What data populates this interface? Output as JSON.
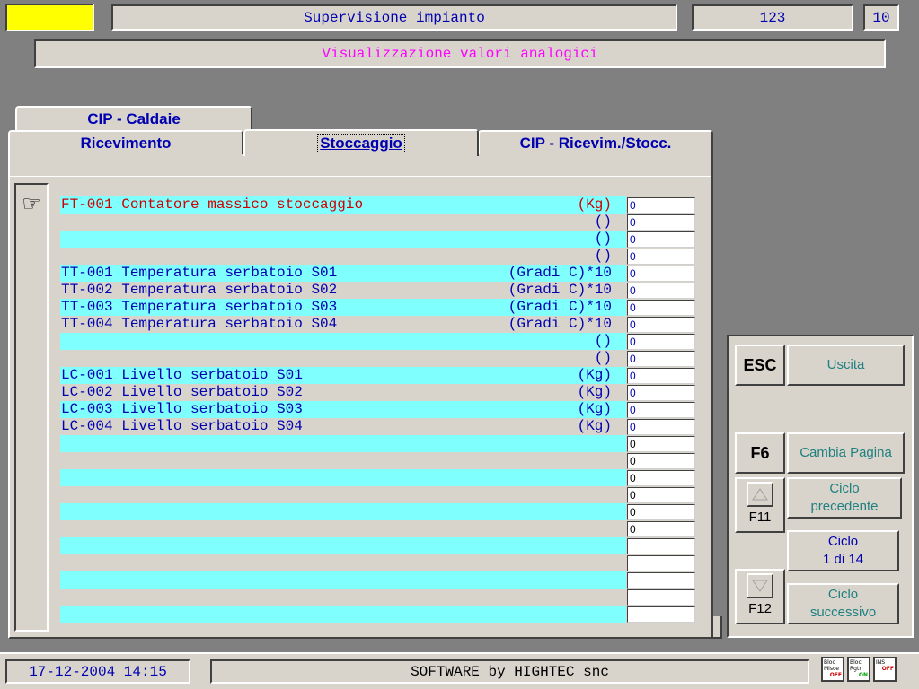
{
  "header": {
    "title": "Supervisione impianto",
    "code": "123",
    "num": "10",
    "subtitle": "Visualizzazione valori analogici"
  },
  "tabs": {
    "back": [
      "CIP - Caldaie"
    ],
    "front": [
      {
        "label": "Ricevimento",
        "active": false
      },
      {
        "label": "Stoccaggio",
        "active": true
      },
      {
        "label": "CIP - Ricevim./Stocc.",
        "active": false
      }
    ]
  },
  "pointer_icon": "☞",
  "rows": [
    {
      "label": "FT-001 Contatore massico stoccaggio",
      "unit": "(Kg)",
      "value": "0",
      "selected": true
    },
    {
      "label": "",
      "unit": "()",
      "value": "0"
    },
    {
      "label": "",
      "unit": "()",
      "value": "0"
    },
    {
      "label": "",
      "unit": "()",
      "value": "0"
    },
    {
      "label": "TT-001 Temperatura serbatoio S01",
      "unit": "(Gradi C)*10",
      "value": "0"
    },
    {
      "label": "TT-002 Temperatura serbatoio S02",
      "unit": "(Gradi C)*10",
      "value": "0"
    },
    {
      "label": "TT-003 Temperatura serbatoio S03",
      "unit": "(Gradi C)*10",
      "value": "0"
    },
    {
      "label": "TT-004 Temperatura serbatoio S04",
      "unit": "(Gradi C)*10",
      "value": "0"
    },
    {
      "label": "",
      "unit": "()",
      "value": "0"
    },
    {
      "label": "",
      "unit": "()",
      "value": "0"
    },
    {
      "label": "LC-001 Livello serbatoio S01",
      "unit": "(Kg)",
      "value": "0"
    },
    {
      "label": "LC-002 Livello serbatoio S02",
      "unit": "(Kg)",
      "value": "0"
    },
    {
      "label": "LC-003 Livello serbatoio S03",
      "unit": "(Kg)",
      "value": "0"
    },
    {
      "label": "LC-004 Livello serbatoio S04",
      "unit": "(Kg)",
      "value": "0"
    },
    {
      "label": "",
      "unit": "",
      "value": "0"
    },
    {
      "label": "",
      "unit": "",
      "value": "0"
    },
    {
      "label": "",
      "unit": "",
      "value": "0"
    },
    {
      "label": "",
      "unit": "",
      "value": "0"
    },
    {
      "label": "",
      "unit": "",
      "value": "0"
    },
    {
      "label": "",
      "unit": "",
      "value": "0"
    },
    {
      "label": "",
      "unit": "",
      "value": ""
    },
    {
      "label": "",
      "unit": "",
      "value": ""
    },
    {
      "label": "",
      "unit": "",
      "value": ""
    },
    {
      "label": "",
      "unit": "",
      "value": ""
    },
    {
      "label": "",
      "unit": "",
      "value": ""
    }
  ],
  "functions": {
    "esc": {
      "key": "ESC",
      "label": "Uscita"
    },
    "f6": {
      "key": "F6",
      "label": "Cambia Pagina"
    },
    "f11": {
      "key": "F11",
      "label": "Ciclo\nprecedente",
      "icon": "up-triangle-icon"
    },
    "cycle": {
      "label": "Ciclo\n1 di 14"
    },
    "f12": {
      "key": "F12",
      "label": "Ciclo\nsuccessivo",
      "icon": "down-triangle-icon"
    }
  },
  "footer": {
    "datetime": "17-12-2004 14:15",
    "software": "SOFTWARE by HIGHTEC snc",
    "indicators": [
      {
        "top": "Bloc",
        "mid": "Misce",
        "state": "OFF",
        "color": "#d00000"
      },
      {
        "top": "Bloc",
        "mid": "Rgtr",
        "state": "ON",
        "color": "#00a000"
      },
      {
        "top": "INS",
        "mid": "",
        "state": "OFF",
        "color": "#d00000"
      }
    ]
  },
  "colors": {
    "row_cyan": "#80ffff",
    "row_gray": "#d8d4cc",
    "text_selected": "#d00000",
    "text_normal": "#0000b0",
    "subtitle": "#ff00ff",
    "status_yellow": "#ffff00"
  }
}
